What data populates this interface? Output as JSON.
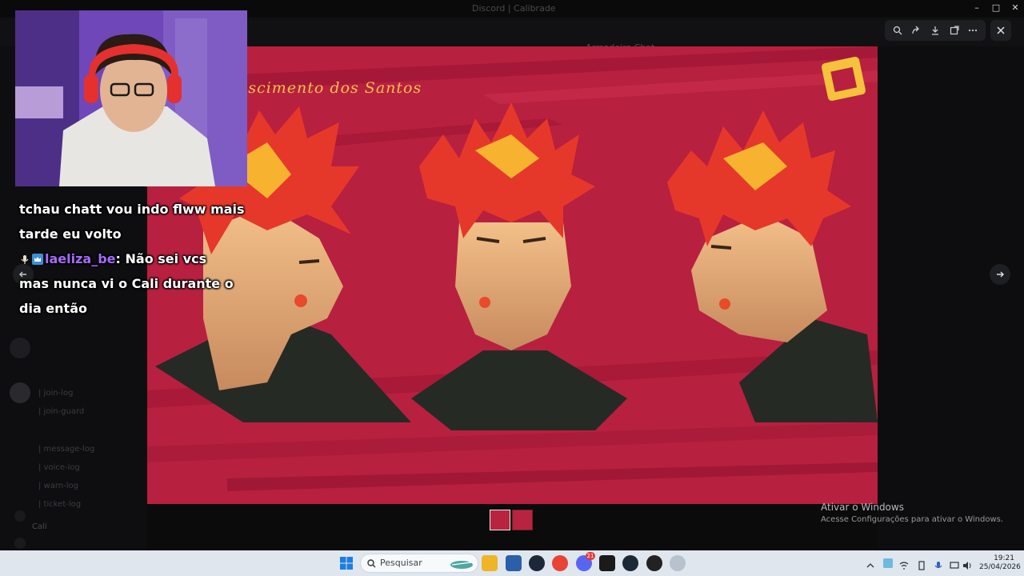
{
  "window": {
    "title": "Discord | Calibrade"
  },
  "header": {
    "channel_name": "Armadeiro Chat"
  },
  "background": {
    "channels": [
      "| join-log",
      "| join-guard",
      "| message-log",
      "| voice-log",
      "| warn-log",
      "| ticket-log"
    ],
    "user_name": "Cali"
  },
  "viewer": {
    "tools": [
      "zoom-in-icon",
      "forward-icon",
      "download-icon",
      "open-external-icon",
      "more-icon"
    ],
    "image_caption": "ascimento dos Santos"
  },
  "chat": {
    "line1": "tchau chatt vou indo flww mais",
    "line2": "tarde eu volto",
    "username": "laeliza_be",
    "separator": ":",
    "message_part1": "Não sei vcs",
    "line4": "mas nunca vi o Cali durante o",
    "line5": "dia então"
  },
  "activation": {
    "title": "Ativar o Windows",
    "subtitle": "Acesse Configurações para ativar o Windows."
  },
  "taskbar": {
    "search_placeholder": "Pesquisar",
    "time": "19:21",
    "date": "25/04/2026",
    "discord_badge": "21"
  },
  "colors": {
    "artwork_bg": "#b8203f",
    "caption": "#f2c04a",
    "chat_username": "#a66bff",
    "taskbar": "#dfe6ee"
  }
}
